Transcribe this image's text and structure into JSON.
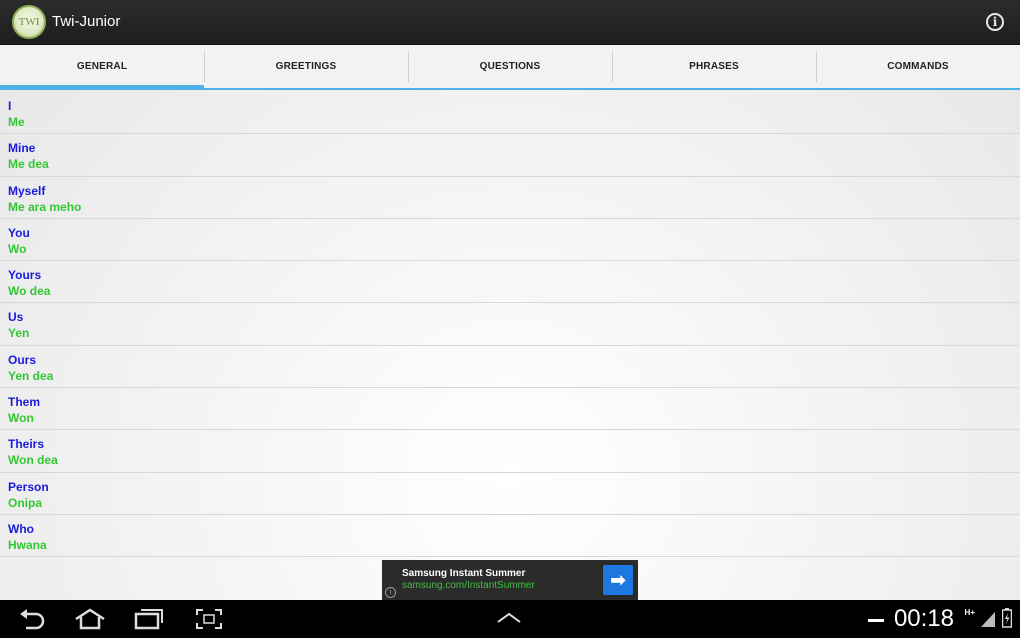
{
  "app": {
    "logo_text": "TWI",
    "title": "Twi-Junior"
  },
  "tabs": [
    {
      "label": "GENERAL",
      "active": true
    },
    {
      "label": "GREETINGS",
      "active": false
    },
    {
      "label": "QUESTIONS",
      "active": false
    },
    {
      "label": "PHRASES",
      "active": false
    },
    {
      "label": "COMMANDS",
      "active": false
    }
  ],
  "list": [
    {
      "english": "I",
      "twi": "Me"
    },
    {
      "english": "Mine",
      "twi": "Me dea"
    },
    {
      "english": "Myself",
      "twi": "Me ara meho"
    },
    {
      "english": "You",
      "twi": "Wo"
    },
    {
      "english": "Yours",
      "twi": "Wo dea"
    },
    {
      "english": "Us",
      "twi": "Yen"
    },
    {
      "english": "Ours",
      "twi": "Yen dea"
    },
    {
      "english": "Them",
      "twi": "Won"
    },
    {
      "english": "Theirs",
      "twi": "Won dea"
    },
    {
      "english": "Person",
      "twi": "Onipa"
    },
    {
      "english": "Who",
      "twi": "Hwana"
    }
  ],
  "ad": {
    "title": "Samsung Instant Summer",
    "url": "samsung.com/InstantSummer"
  },
  "status": {
    "time": "00:18",
    "network": "H+"
  },
  "colors": {
    "accent": "#4db2e4",
    "english_text": "#1a1adc",
    "twi_text": "#34c734"
  }
}
